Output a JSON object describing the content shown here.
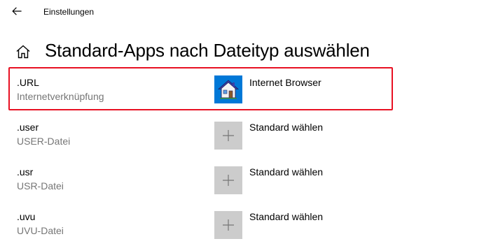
{
  "window": {
    "title": "Einstellungen"
  },
  "page": {
    "title": "Standard-Apps nach Dateityp auswählen"
  },
  "rows": [
    {
      "extension": ".URL",
      "description": "Internetverknüpfung",
      "app_label": "Internet Browser",
      "app_icon": "house-icon",
      "highlighted": true
    },
    {
      "extension": ".user",
      "description": "USER-Datei",
      "app_label": "Standard wählen",
      "app_icon": "plus-icon",
      "highlighted": false
    },
    {
      "extension": ".usr",
      "description": "USR-Datei",
      "app_label": "Standard wählen",
      "app_icon": "plus-icon",
      "highlighted": false
    },
    {
      "extension": ".uvu",
      "description": "UVU-Datei",
      "app_label": "Standard wählen",
      "app_icon": "plus-icon",
      "highlighted": false
    }
  ],
  "colors": {
    "accent": "#0078d7",
    "highlight_border": "#e81123",
    "secondary_text": "#767676",
    "empty_tile": "#cccccc"
  }
}
